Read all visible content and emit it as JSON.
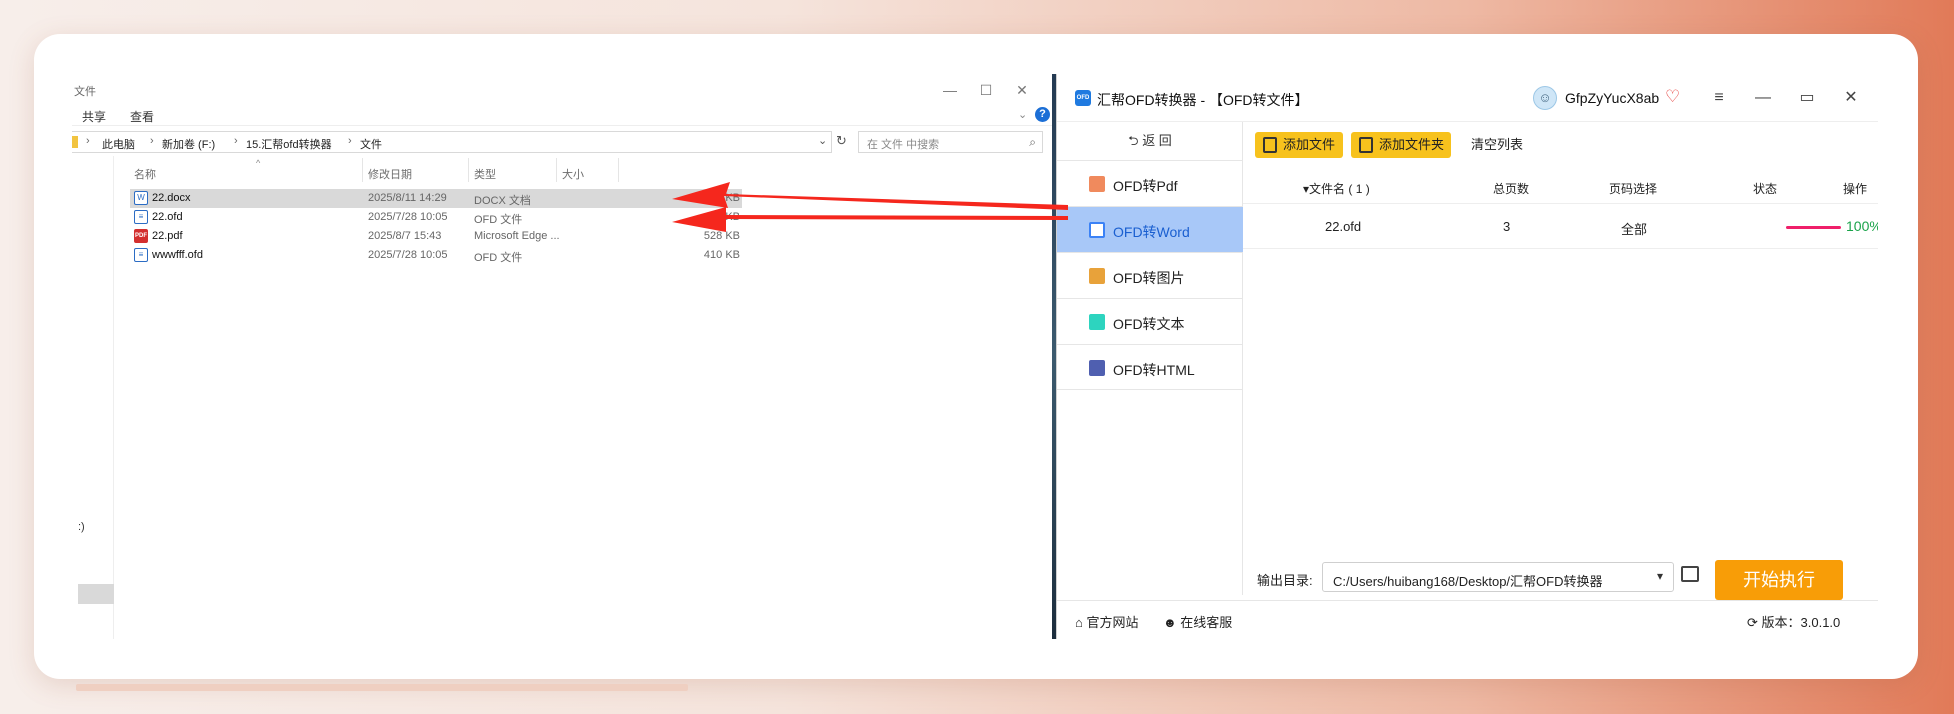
{
  "explorer": {
    "title_fragment": "文件",
    "controls": {
      "minimize": "—",
      "maximize": "☐",
      "close": "✕"
    },
    "ribbon_tabs": [
      "共享",
      "查看"
    ],
    "ribbon_collapse": "⌄",
    "help": "?",
    "breadcrumb": [
      "此电脑",
      "新加卷 (F:)",
      "15.汇帮ofd转换器",
      "文件"
    ],
    "breadcrumb_sep": "›",
    "address_dropdown": "⌄",
    "refresh": "↻",
    "search_placeholder": "在 文件 中搜索",
    "nav_pane_text": ":)",
    "columns": [
      "名称",
      "修改日期",
      "类型",
      "大小"
    ],
    "sort_caret": "^",
    "files": [
      {
        "name": "22.docx",
        "date": "2025/8/11 14:29",
        "type": "DOCX 文档",
        "size": "193 KB",
        "icon": "word-doc-icon",
        "selected": true
      },
      {
        "name": "22.ofd",
        "date": "2025/7/28 10:05",
        "type": "OFD 文件",
        "size": "109 KB",
        "icon": "ofd-file-icon"
      },
      {
        "name": "22.pdf",
        "date": "2025/8/7 15:43",
        "type": "Microsoft Edge ...",
        "size": "528 KB",
        "icon": "pdf-file-icon"
      },
      {
        "name": "wwwfff.ofd",
        "date": "2025/7/28 10:05",
        "type": "OFD 文件",
        "size": "410 KB",
        "icon": "ofd-file-icon"
      }
    ]
  },
  "converter": {
    "logo_text": "OFD",
    "title": "汇帮OFD转换器 - 【OFD转文件】",
    "username": "GfpZyYucX8ab",
    "vip_icon": "♡",
    "controls": {
      "menu": "≡",
      "minimize": "—",
      "maximize": "▭",
      "close": "✕"
    },
    "back_label": "⮌ 返  回",
    "menu": [
      {
        "label": "OFD转Pdf",
        "color": "#f08a5d"
      },
      {
        "label": "OFD转Word",
        "color": "#3b82f6",
        "active": true
      },
      {
        "label": "OFD转图片",
        "color": "#e8a23a"
      },
      {
        "label": "OFD转文本",
        "color": "#2dd4bf"
      },
      {
        "label": "OFD转HTML",
        "color": "#4f5fb0"
      }
    ],
    "toolbar": {
      "add_file": "添加文件",
      "add_folder": "添加文件夹",
      "clear_list": "清空列表"
    },
    "table_headers": [
      "▾文件名 ( 1 )",
      "总页数",
      "页码选择",
      "状态",
      "操作"
    ],
    "rows": [
      {
        "filename": "22.ofd",
        "pages": "3",
        "page_select": "全部",
        "status": "100%",
        "progress": 1.0
      }
    ],
    "output_label": "输出目录:",
    "output_path": "C:/Users/huibang168/Desktop/汇帮OFD转换器",
    "start_button": "开始执行",
    "footer": {
      "website": "官方网站",
      "support": "在线客服",
      "version": "版本：3.0.1.0"
    },
    "accent": "#f89d07",
    "toolbar_color": "#f7c21d",
    "active_menu_bg": "#a8c8f8"
  }
}
